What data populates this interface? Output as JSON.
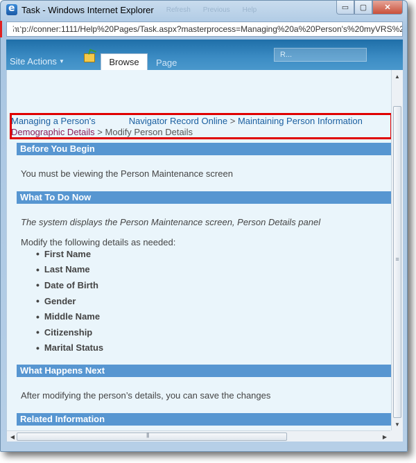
{
  "window": {
    "title": "Task - Windows Internet Explorer",
    "menu_ghost": [
      "Refresh",
      "Previous",
      "Help"
    ],
    "min": "▭",
    "max": "▢",
    "close": "✕"
  },
  "address": {
    "url": "http://conner:1111/Help%20Pages/Task.aspx?masterprocess=Managing%20a%20Person's%20myVRS%2"
  },
  "ribbon": {
    "site_actions": "Site Actions",
    "tab_browse": "Browse",
    "tab_page": "Page",
    "user": "R..."
  },
  "breadcrumb": {
    "link1": "Managing a Person's",
    "link1b": "Navigator Record Online",
    "sep": ">",
    "link2": "Maintaining Person Information",
    "link3": "Demographic Details",
    "current": "Modify Person Details"
  },
  "sections": {
    "before": {
      "title": "Before You Begin",
      "text": "You must be viewing the Person Maintenance screen"
    },
    "todo": {
      "title": "What To Do Now",
      "italic_text": "The system displays the Person Maintenance screen, Person Details panel",
      "intro": "Modify the following details as needed:",
      "items": [
        "First Name",
        "Last Name",
        "Date of Birth",
        "Gender",
        "Middle Name",
        "Citizenship",
        "Marital Status"
      ]
    },
    "next": {
      "title": "What Happens Next",
      "text": "After modifying the person’s details, you can save the changes"
    },
    "related": {
      "title": "Related Information"
    }
  },
  "colors": {
    "section_bar": "#5796d1",
    "highlight": "#e00000",
    "link": "#1a5fa0",
    "link_visited": "#8a1f5b"
  },
  "icons": [
    "ie-logo-icon",
    "site-icon",
    "folder-upload-icon",
    "scroll-up-icon",
    "scroll-down-icon",
    "scroll-left-icon",
    "scroll-right-icon"
  ]
}
